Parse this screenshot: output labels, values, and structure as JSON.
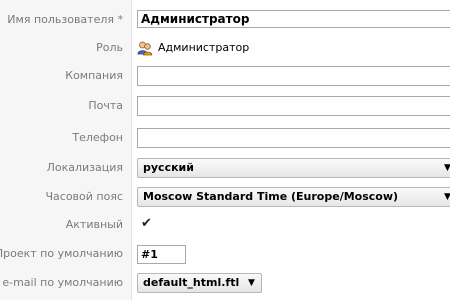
{
  "fields": {
    "username": {
      "label": "Имя пользователя *",
      "value": "Администратор"
    },
    "role": {
      "label": "Роль",
      "value": "Администратор",
      "icon": "users-icon"
    },
    "company": {
      "label": "Компания",
      "value": ""
    },
    "email": {
      "label": "Почта",
      "value": ""
    },
    "phone": {
      "label": "Телефон",
      "value": ""
    },
    "locale": {
      "label": "Локализация",
      "value": "русский"
    },
    "timezone": {
      "label": "Часовой пояс",
      "value": "Moscow Standard Time (Europe/Moscow)"
    },
    "active": {
      "label": "Активный",
      "checked": true
    },
    "default_project": {
      "label": "Проект по умолчанию",
      "value": "#1"
    },
    "default_email": {
      "label": "e-mail по умолчанию",
      "value": "default_html.ftl"
    }
  },
  "colors": {
    "label_text": "#7a7a7a",
    "label_bg": "#f6f6f6",
    "field_border": "#a9a9a9"
  }
}
